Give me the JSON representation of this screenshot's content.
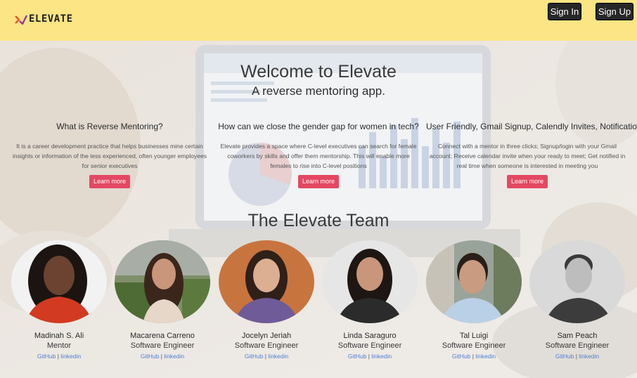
{
  "brand": {
    "name": "ELEVATE"
  },
  "nav": {
    "signin": "Sign In",
    "signup": "Sign Up"
  },
  "hero": {
    "title": "Welcome to Elevate",
    "subtitle": "A reverse mentoring app."
  },
  "features": [
    {
      "title": "What is Reverse Mentoring?",
      "text": "It is a career development practice that helps businesses mine certain insights or information of the less experienced, often younger employees for senior executives",
      "button": "Learn more"
    },
    {
      "title": "How can we close the gender gap for women in tech?",
      "text": "Elevate provides a space where C-level executives can search for female coworkers by skills and offer them mentorship. This will enable more females to rise into C-level positions",
      "button": "Learn more"
    },
    {
      "title": "User Friendly, Gmail Signup, Calendly Invites, Notifications",
      "text": "Connect with a mentor in three clicks; Signup/login with your Gmail account; Receive calendar invite when your ready to meet; Get notified in real time when someone is interested in meeting you",
      "button": "Learn more"
    }
  ],
  "team": {
    "title": "The Elevate Team",
    "separator": "|",
    "members": [
      {
        "name": "Madinah S. Ali",
        "role": "Mentor",
        "github": "GitHub",
        "linkedin": "linkedin"
      },
      {
        "name": "Macarena Carreno",
        "role": "Software Engineer",
        "github": "GitHub",
        "linkedin": "linkedin"
      },
      {
        "name": "Jocelyn Jeriah",
        "role": "Software Engineer",
        "github": "GitHub",
        "linkedin": "linkedin"
      },
      {
        "name": "Linda Saraguro",
        "role": "Software Engineer",
        "github": "GitHub",
        "linkedin": "linkedin"
      },
      {
        "name": "Tal Luigi",
        "role": "Software Engineer",
        "github": "GitHub",
        "linkedin": "linkedin"
      },
      {
        "name": "Sam Peach",
        "role": "Software Engineer",
        "github": "GitHub",
        "linkedin": "linkedin"
      }
    ]
  },
  "colors": {
    "navbar": "#fbe584",
    "accent": "#e44862",
    "link": "#4f7fd1",
    "button_dark": "#272727"
  }
}
